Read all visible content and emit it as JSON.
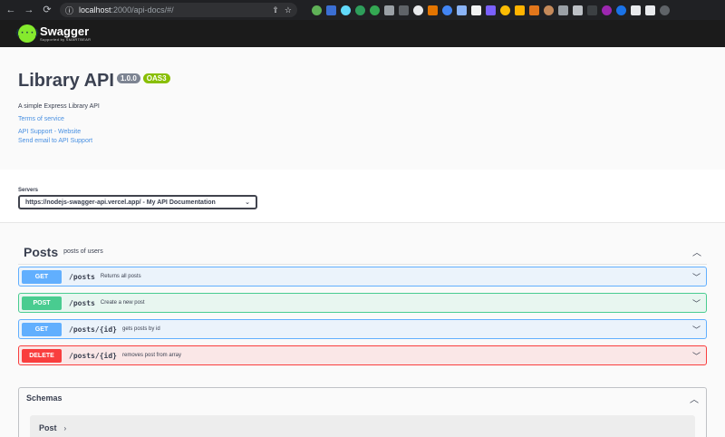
{
  "browser": {
    "url_host": "localhost",
    "url_path": ":2000/api-docs/#/",
    "back_icon": "arrow-left",
    "forward_icon": "arrow-right",
    "reload_icon": "reload",
    "info_icon": "info"
  },
  "topbar": {
    "logo_mark": "{···}",
    "logo_name": "Swagger",
    "logo_sub": "Supported by SMARTBEAR"
  },
  "info": {
    "title": "Library API",
    "version": "1.0.0",
    "spec": "OAS3",
    "description": "A simple Express Library API",
    "terms": "Terms of service",
    "support_website": "API Support - Website",
    "support_email": "Send email to API Support"
  },
  "servers": {
    "label": "Servers",
    "selected": "https://nodejs-swagger-api.vercel.app/ - My API Documentation"
  },
  "tag": {
    "name": "Posts",
    "description": "posts of users"
  },
  "operations": [
    {
      "method": "GET",
      "path": "/posts",
      "summary": "Returns all posts"
    },
    {
      "method": "POST",
      "path": "/posts",
      "summary": "Create a new post"
    },
    {
      "method": "GET",
      "path": "/posts/{id}",
      "summary": "gets posts by id"
    },
    {
      "method": "DELETE",
      "path": "/posts/{id}",
      "summary": "removes post from array"
    }
  ],
  "schemas": {
    "title": "Schemas",
    "models": [
      {
        "name": "Post"
      }
    ]
  }
}
